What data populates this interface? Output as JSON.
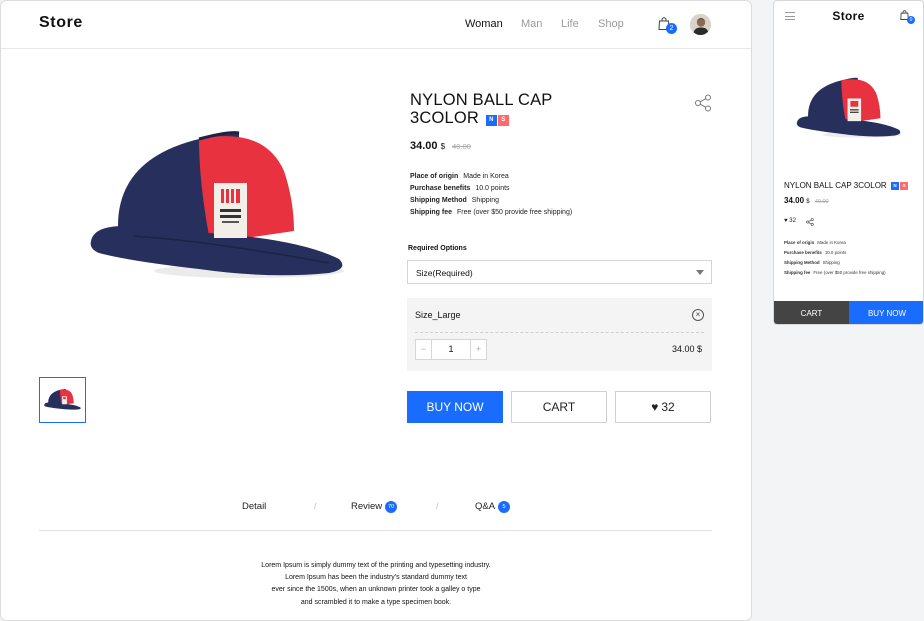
{
  "desktop": {
    "header": {
      "logo": "Store",
      "nav": [
        "Woman",
        "Man",
        "Life",
        "Shop"
      ],
      "active_nav": "Woman",
      "cart_count": "2"
    },
    "product": {
      "title_line1": "NYLON BALL CAP",
      "title_line2": "3COLOR",
      "tag_n": "N",
      "tag_s": "S",
      "price": "34.00",
      "currency": "$",
      "old_price": "40.00",
      "info": [
        {
          "label": "Place of origin",
          "value": "Made in Korea"
        },
        {
          "label": "Purchase benefits",
          "value": "10.0 points"
        },
        {
          "label": "Shipping Method",
          "value": "Shipping"
        },
        {
          "label": "Shipping fee",
          "value": "Free (over $50 provide free shipping)"
        }
      ],
      "required_options_label": "Required Options",
      "size_select_value": "Size(Required)",
      "selected_option": {
        "name": "Size_Large",
        "quantity": "1",
        "price": "34.00 $",
        "minus": "−",
        "plus": "+"
      }
    },
    "actions": {
      "buy_now": "BUY NOW",
      "cart": "CART",
      "likes": "32"
    },
    "tabs": {
      "detail": "Detail",
      "review": "Review",
      "review_count": "70",
      "qa": "Q&A",
      "qa_count": "5",
      "separator": "/"
    },
    "description": [
      "Lorem Ipsum is simply dummy text of the printing and typesetting industry.",
      "Lorem Ipsum has been the industry's standard dummy text",
      "ever since the 1500s, when an unknown printer took a galley o type",
      "and scrambled it to make a type specimen book."
    ]
  },
  "mobile": {
    "logo": "Store",
    "cart_count": "0",
    "title": "NYLON BALL CAP 3COLOR",
    "tag_n": "N",
    "tag_s": "S",
    "price": "34.00",
    "currency": "$",
    "old_price": "40.00",
    "likes": "32",
    "info": [
      {
        "label": "Place of origin",
        "value": "Made in Korea"
      },
      {
        "label": "Purchase benefits",
        "value": "10.0 points"
      },
      {
        "label": "Shipping Method",
        "value": "Shipping"
      },
      {
        "label": "Shipping fee",
        "value": "Free (over $50 provide free shipping)"
      }
    ],
    "cart": "CART",
    "buy_now": "BUY NOW"
  },
  "colors": {
    "accent": "#1a6cff",
    "tag_s": "#ff6b6b",
    "cap_red": "#e8323f",
    "cap_navy": "#27305c",
    "mobile_cart_bg": "#444444"
  },
  "icons": [
    "shopping-bag-icon",
    "avatar",
    "share-icon",
    "caret-down-icon",
    "close-circle-icon",
    "heart-icon",
    "menu-icon"
  ]
}
